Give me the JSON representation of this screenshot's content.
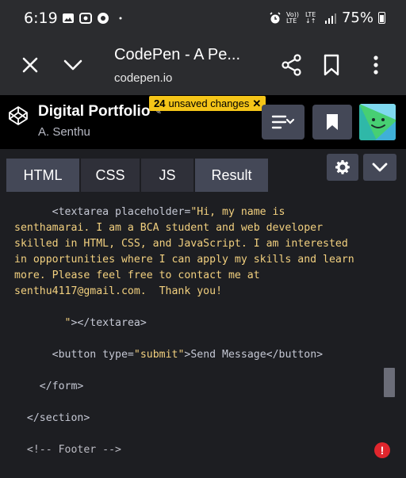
{
  "status_bar": {
    "time": "6:19",
    "signal_label_1": "Vo)) LTE",
    "signal_label_2": "LTE ↓↑",
    "battery": "75%"
  },
  "browser": {
    "title": "CodePen - A Pe...",
    "url": "codepen.io",
    "icons": [
      "close-icon",
      "chevron-down-icon",
      "share-icon",
      "bookmark-icon",
      "more-vert-icon"
    ]
  },
  "pen": {
    "title": "Digital Portfolio",
    "author": "A. Senthu",
    "unsaved_count": "24",
    "unsaved_text": "unsaved changes",
    "unsaved_close": "✕"
  },
  "tabs": [
    {
      "label": "HTML",
      "active": true
    },
    {
      "label": "CSS",
      "active": false
    },
    {
      "label": "JS",
      "active": false
    },
    {
      "label": "Result",
      "active": true
    }
  ],
  "code": {
    "l1_indent": "      ",
    "l1_tag_open": "<textarea ",
    "l1_attr": "placeholder=",
    "l1_str": "\"Hi, my name is",
    "l2": "senthamarai. I am a BCA student and web developer",
    "l3": "skilled in HTML, CSS, and JavaScript. I am interested",
    "l4": "in opportunities where I can apply my skills and learn",
    "l5": "more. Please feel free to contact me at",
    "l6": "senthu4117@gmail.com.  Thank you!",
    "l7_indent": "        ",
    "l7_str": "\"",
    "l7_tag": "></textarea>",
    "l8_indent": "      ",
    "l8_tag_open": "<button ",
    "l8_attr": "type=",
    "l8_str": "\"submit\"",
    "l8_gt": ">",
    "l8_text": "Send Message",
    "l8_tag_close": "</button>",
    "l9": "    </form>",
    "l10": "  </section>",
    "l11": "  <!-- Footer -->"
  },
  "error_badge": "!",
  "colors": {
    "editor_bg": "#1d1e22",
    "header_bg": "#000000",
    "unsaved_badge": "#f5c518",
    "string": "#f2d07f",
    "error": "#e0262d"
  }
}
